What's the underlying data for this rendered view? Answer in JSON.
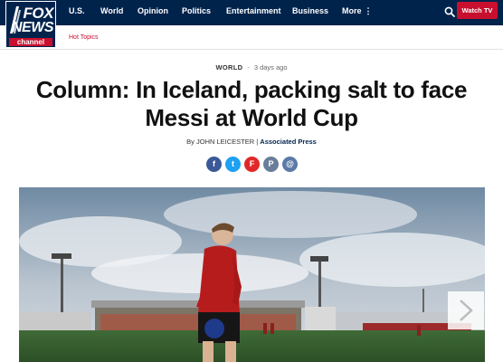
{
  "header": {
    "logo": {
      "line1": "FOX",
      "line2": "NEWS",
      "line3": "channel"
    },
    "nav": [
      "U.S.",
      "World",
      "Opinion",
      "Politics",
      "Entertainment",
      "Business",
      "More"
    ],
    "watch_label": "Watch TV"
  },
  "subnav": {
    "hot_topics": "Hot Topics"
  },
  "article": {
    "category": "WORLD",
    "separator": "-",
    "time_ago": "3 days ago",
    "headline": "Column: In Iceland, packing salt to face Messi at World Cup",
    "byline_prefix": "By JOHN LEICESTER | ",
    "byline_source": "Associated Press"
  },
  "share": [
    {
      "icon": "facebook-icon",
      "glyph": "f",
      "color": "#3b5998"
    },
    {
      "icon": "twitter-icon",
      "glyph": "t",
      "color": "#1da1f2"
    },
    {
      "icon": "flipboard-icon",
      "glyph": "F",
      "color": "#e12828"
    },
    {
      "icon": "print-icon",
      "glyph": "P",
      "color": "#6a7d9b"
    },
    {
      "icon": "email-icon",
      "glyph": "@",
      "color": "#5b7aa8"
    }
  ],
  "colors": {
    "brand_navy": "#00234c",
    "brand_red": "#c8102e"
  }
}
